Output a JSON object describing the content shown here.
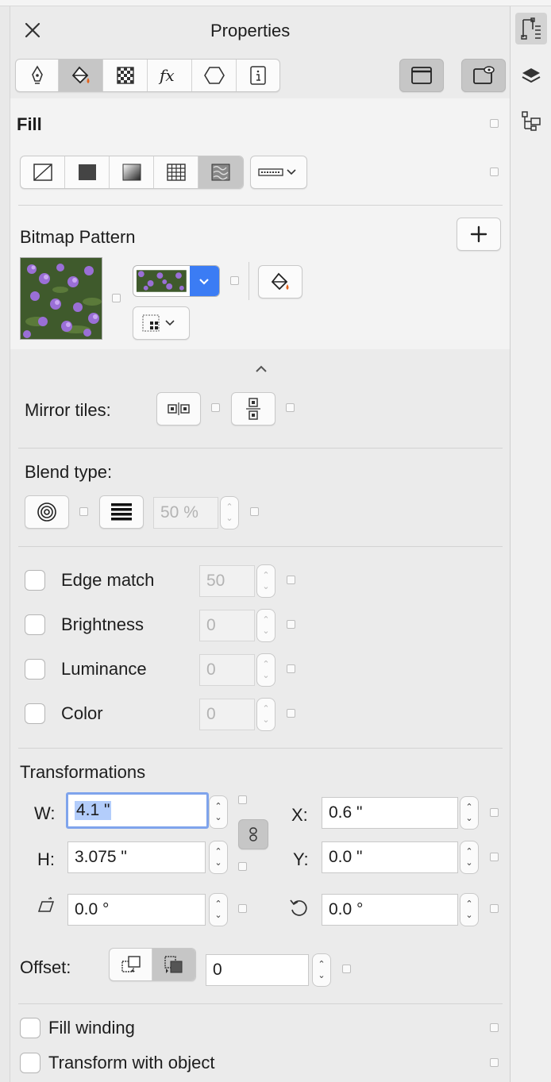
{
  "panel": {
    "title": "Properties"
  },
  "fill": {
    "heading": "Fill",
    "pattern_label": "Bitmap Pattern"
  },
  "mirror": {
    "label": "Mirror tiles:"
  },
  "blend": {
    "label": "Blend type:",
    "percent": "50 %"
  },
  "adjust": {
    "items": [
      {
        "label": "Edge match",
        "value": "50"
      },
      {
        "label": "Brightness",
        "value": "0"
      },
      {
        "label": "Luminance",
        "value": "0"
      },
      {
        "label": "Color",
        "value": "0"
      }
    ]
  },
  "transform": {
    "heading": "Transformations",
    "w_label": "W:",
    "w_value": "4.1 \"",
    "h_label": "H:",
    "h_value": "3.075 \"",
    "x_label": "X:",
    "x_value": "0.6 \"",
    "y_label": "Y:",
    "y_value": "0.0 \"",
    "skew_value": "0.0 °",
    "rotate_value": "0.0 °"
  },
  "offset": {
    "label": "Offset:",
    "value": "0"
  },
  "options": {
    "fill_winding": "Fill winding",
    "transform_with_object": "Transform with object"
  },
  "colors": {
    "accent": "#3b7cf4",
    "focus": "#7fa4ec",
    "fill_accent": "#e4631c"
  }
}
